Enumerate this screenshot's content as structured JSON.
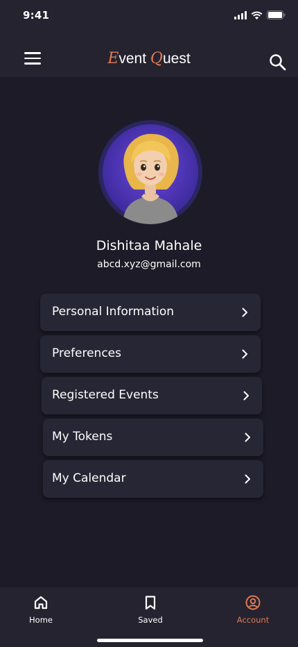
{
  "status_bar": {
    "time": "9:41"
  },
  "header": {
    "title_first_cap": "E",
    "title_first_rest": "vent",
    "title_second_cap": "Q",
    "title_second_rest": "uest"
  },
  "profile": {
    "name": "Dishitaa Mahale",
    "email": "abcd.xyz@gmail.com"
  },
  "menu": [
    {
      "label": "Personal Information"
    },
    {
      "label": "Preferences"
    },
    {
      "label": "Registered Events"
    },
    {
      "label": "My Tokens"
    },
    {
      "label": "My Calendar"
    }
  ],
  "bottom_nav": [
    {
      "label": "Home",
      "icon": "home-icon"
    },
    {
      "label": "Saved",
      "icon": "bookmark-icon"
    },
    {
      "label": "Account",
      "icon": "account-icon",
      "active": true
    }
  ],
  "colors": {
    "background": "#1c1b27",
    "bar": "#24232f",
    "card": "#272634",
    "accent": "#e07a55"
  }
}
